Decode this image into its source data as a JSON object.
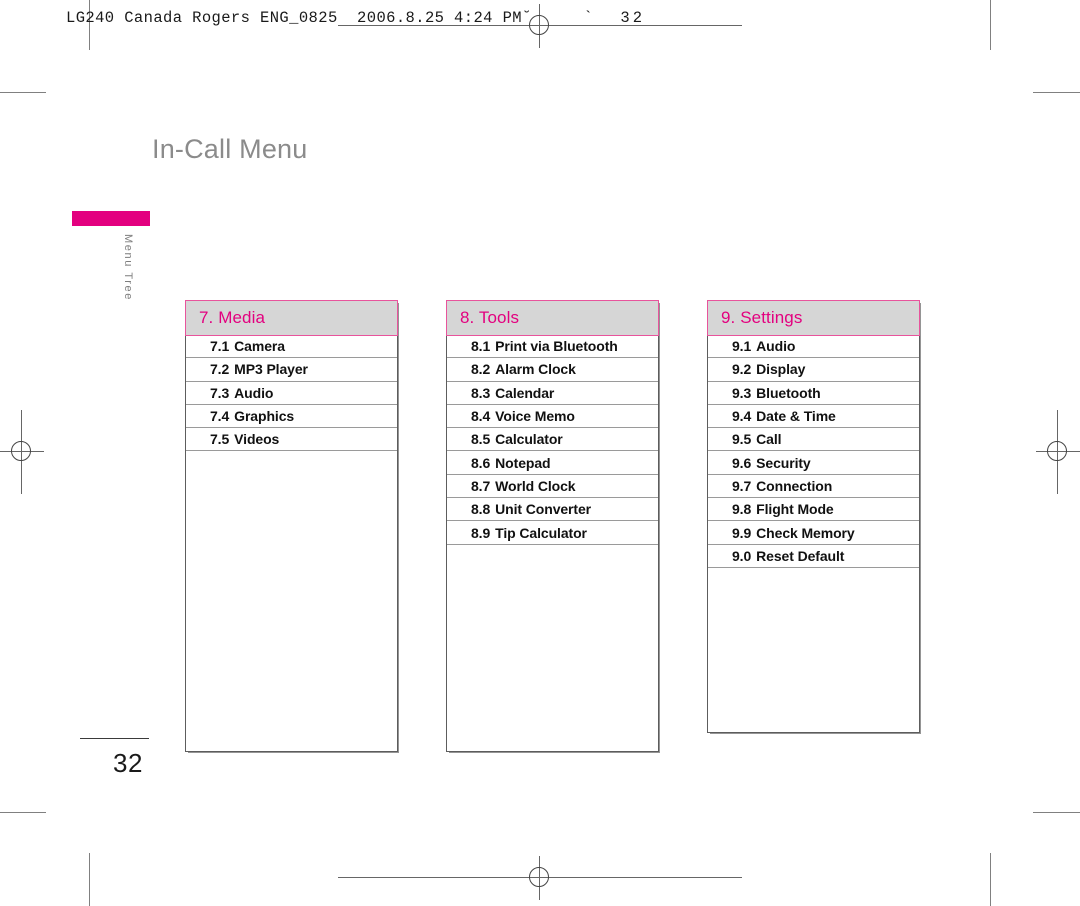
{
  "print_header": {
    "text": "LG240 Canada Rogers ENG_0825  2006.8.25 4:24 PM",
    "tail": "˘    `  32"
  },
  "page": {
    "title": "In-Call Menu",
    "number": "32",
    "side_tab_label": "Menu Tree",
    "accent_color": "#e3007f",
    "header_fill": "#d6d6d6"
  },
  "columns": [
    {
      "id": "media",
      "header_num": "7.",
      "header_label": "Media",
      "header_text": "7. Media",
      "rows": [
        {
          "num": "7.1",
          "label": "Camera"
        },
        {
          "num": "7.2",
          "label": "MP3 Player"
        },
        {
          "num": "7.3",
          "label": "Audio"
        },
        {
          "num": "7.4",
          "label": "Graphics"
        },
        {
          "num": "7.5",
          "label": "Videos"
        }
      ]
    },
    {
      "id": "tools",
      "header_num": "8.",
      "header_label": "Tools",
      "header_text": "8. Tools",
      "rows": [
        {
          "num": "8.1",
          "label": "Print via Bluetooth"
        },
        {
          "num": "8.2",
          "label": "Alarm Clock"
        },
        {
          "num": "8.3",
          "label": "Calendar"
        },
        {
          "num": "8.4",
          "label": "Voice Memo"
        },
        {
          "num": "8.5",
          "label": "Calculator"
        },
        {
          "num": "8.6",
          "label": "Notepad"
        },
        {
          "num": "8.7",
          "label": "World Clock"
        },
        {
          "num": "8.8",
          "label": "Unit Converter"
        },
        {
          "num": "8.9",
          "label": "Tip Calculator"
        }
      ]
    },
    {
      "id": "settings",
      "header_num": "9.",
      "header_label": "Settings",
      "header_text": "9. Settings",
      "rows": [
        {
          "num": "9.1",
          "label": "Audio"
        },
        {
          "num": "9.2",
          "label": "Display"
        },
        {
          "num": "9.3",
          "label": "Bluetooth"
        },
        {
          "num": "9.4",
          "label": "Date & Time"
        },
        {
          "num": "9.5",
          "label": "Call"
        },
        {
          "num": "9.6",
          "label": "Security"
        },
        {
          "num": "9.7",
          "label": "Connection"
        },
        {
          "num": "9.8",
          "label": "Flight Mode"
        },
        {
          "num": "9.9",
          "label": "Check Memory"
        },
        {
          "num": "9.0",
          "label": "Reset Default"
        }
      ]
    }
  ]
}
